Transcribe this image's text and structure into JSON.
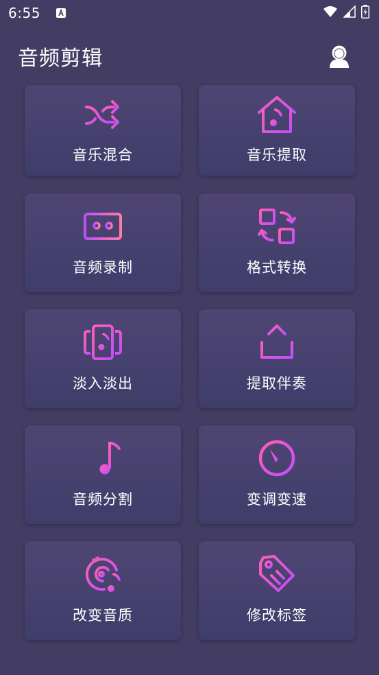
{
  "status_bar": {
    "time": "6:55",
    "icons": [
      "text-a-icon",
      "wifi-icon",
      "signal-icon",
      "battery-icon"
    ]
  },
  "app": {
    "title": "音频剪辑",
    "profile_icon": "person-icon"
  },
  "colors": {
    "background": "#433c63",
    "card_top": "#4f4573",
    "card_bottom": "#3f3d6a",
    "icon_gradient_start": "#ff5fb5",
    "icon_gradient_end": "#c24dff"
  },
  "tools": [
    {
      "label": "音乐混合",
      "icon": "shuffle-icon"
    },
    {
      "label": "音乐提取",
      "icon": "music-house-icon"
    },
    {
      "label": "音频录制",
      "icon": "cassette-icon"
    },
    {
      "label": "格式转换",
      "icon": "convert-icon"
    },
    {
      "label": "淡入淡出",
      "icon": "fade-music-icon"
    },
    {
      "label": "提取伴奏",
      "icon": "upload-icon"
    },
    {
      "label": "音频分割",
      "icon": "music-list-icon"
    },
    {
      "label": "变调变速",
      "icon": "speed-dial-icon"
    },
    {
      "label": "改变音质",
      "icon": "disc-music-icon"
    },
    {
      "label": "修改标签",
      "icon": "tag-icon"
    }
  ]
}
